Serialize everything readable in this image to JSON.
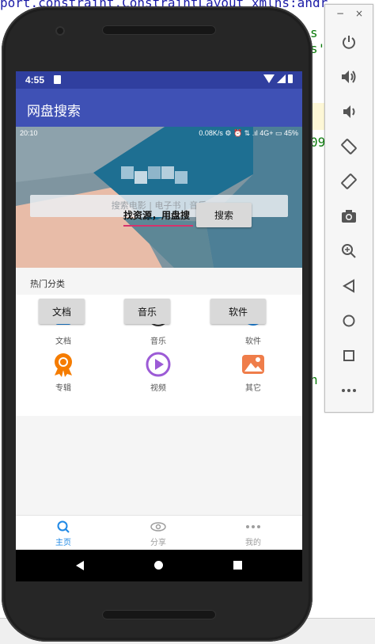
{
  "ide": {
    "line1": "port.constraint.ConstraintLayout xmlns:andr",
    "frag1": "s",
    "frag2": "s'",
    "frag3": "09",
    "frag4": "n"
  },
  "device": {
    "status_time": "4:55",
    "app_title": "网盘搜索",
    "banner": {
      "inner_time": "20:10",
      "inner_status": "0.08K/s ⚙ ⏰ ⇅ .ıl 4G+ ▭ 45%",
      "search_placeholder": "搜索电影 | 电子书 | 音乐",
      "slogan": "找资源，用盘搜",
      "search_button": "搜索"
    },
    "hot_label": "热门分类",
    "buttons": {
      "doc": "文档",
      "music": "音乐",
      "software": "软件"
    },
    "categories": [
      {
        "label": "文档",
        "icon": "document-icon"
      },
      {
        "label": "音乐",
        "icon": "music-icon"
      },
      {
        "label": "软件",
        "icon": "software-icon"
      },
      {
        "label": "专辑",
        "icon": "album-badge-icon"
      },
      {
        "label": "视频",
        "icon": "video-play-icon"
      },
      {
        "label": "其它",
        "icon": "image-other-icon"
      }
    ],
    "bottom_nav": [
      {
        "label": "主页",
        "icon": "search-icon",
        "active": true
      },
      {
        "label": "分享",
        "icon": "eye-icon",
        "active": false
      },
      {
        "label": "我的",
        "icon": "more-dots-icon",
        "active": false
      }
    ],
    "colors": {
      "primary": "#3f51b5",
      "primary_dark": "#303f9f",
      "active_nav": "#1e88e5",
      "inactive_nav": "#9e9e9e"
    }
  },
  "emulator_panel": {
    "minimize": "−",
    "close": "×",
    "tools": [
      "power-icon",
      "volume-up-icon",
      "volume-down-icon",
      "rotate-left-icon",
      "rotate-right-icon",
      "camera-icon",
      "zoom-icon",
      "back-icon",
      "home-icon",
      "overview-icon",
      "more-icon"
    ]
  }
}
